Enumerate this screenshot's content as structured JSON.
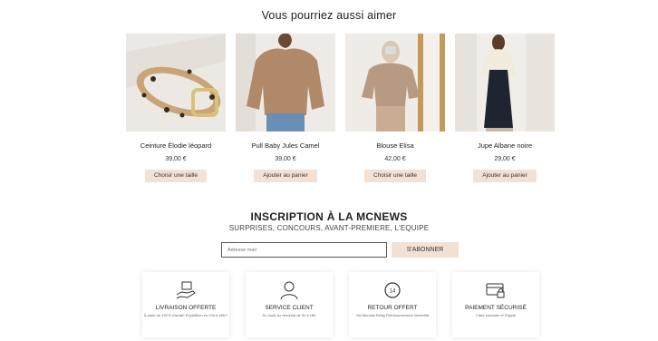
{
  "section": {
    "title": "Vous pourriez aussi aimer"
  },
  "products": [
    {
      "name": "Ceinture Élodie léopard",
      "price": "39,00 €",
      "button": "Choisir une taille"
    },
    {
      "name": "Pull Baby Jules Camel",
      "price": "39,00 €",
      "button": "Ajouter au panier"
    },
    {
      "name": "Blouse Elisa",
      "price": "42,00 €",
      "button": "Choisir une taille"
    },
    {
      "name": "Jupe Albane noire",
      "price": "29,00 €",
      "button": "Ajouter au panier"
    }
  ],
  "newsletter": {
    "title": "INSCRIPTION À LA MCNEWS",
    "subtitle": "SURPRISES, CONCOURS, AVANT-PREMIERE, L'EQUIPE",
    "placeholder": "Adresse mail",
    "button": "S'ABONNER"
  },
  "features": [
    {
      "icon": "delivery-box-icon",
      "title": "LIVRAISON OFFERTE",
      "desc": "À partir de 100 € d'achat* Expédition en 24h à 48h**"
    },
    {
      "icon": "user-icon",
      "title": "SERVICE CLIENT",
      "desc": "Du lundi au vendredi de 9h à 18h"
    },
    {
      "icon": "return-14-icon",
      "title": "RETOUR OFFERT",
      "desc": "Via Mondial Relay Remboursement immédiat"
    },
    {
      "icon": "secure-card-icon",
      "title": "PAIEMENT SÉCURISÉ",
      "desc": "Carte bancaire et Paypal"
    }
  ],
  "colors": {
    "accent": "#f3e2d4",
    "text": "#222222"
  }
}
